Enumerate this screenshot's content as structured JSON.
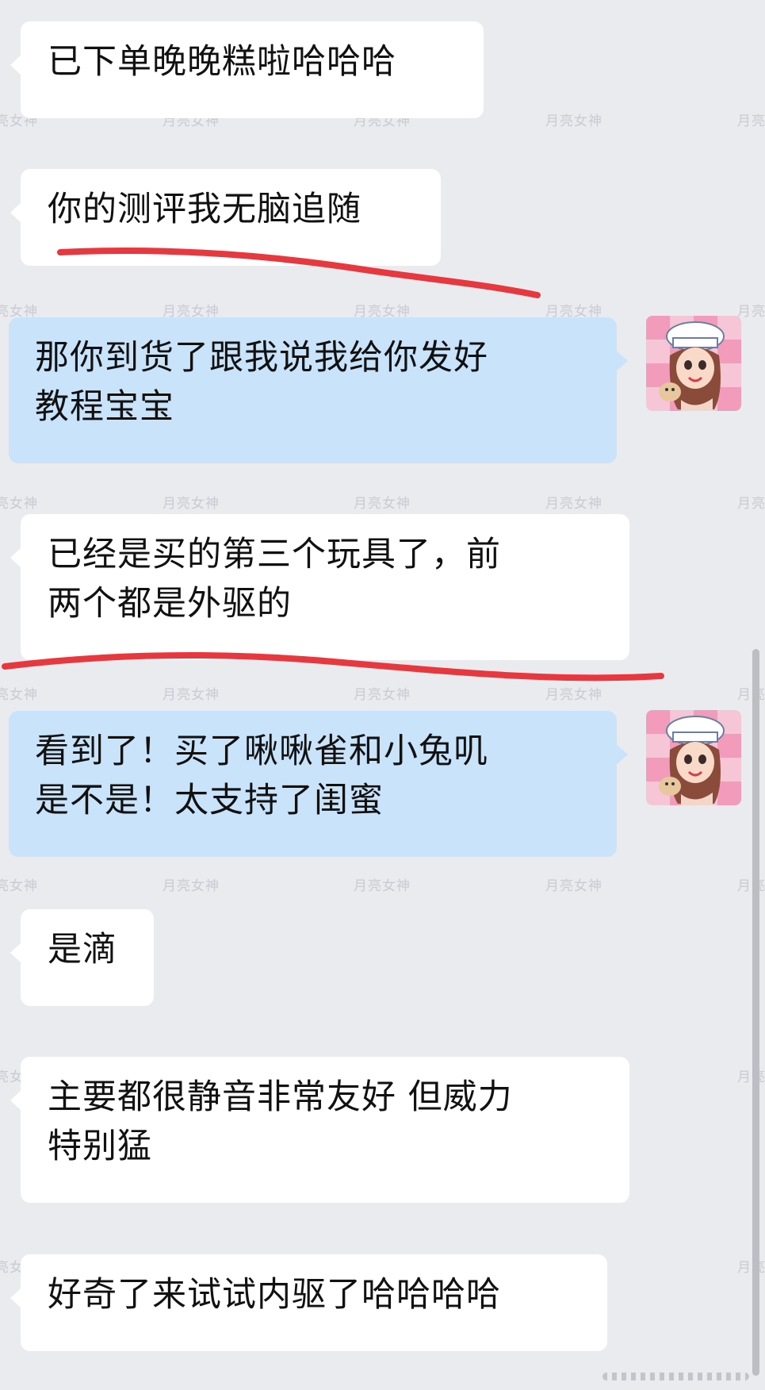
{
  "watermark": "月亮女神",
  "messages": [
    {
      "side": "in",
      "lines": [
        "已下单晚晚糕啦哈哈哈"
      ]
    },
    {
      "side": "in",
      "lines": [
        "你的测评我无脑追随"
      ]
    },
    {
      "side": "out",
      "lines": [
        "那你到货了跟我说我给你发好",
        "教程宝宝"
      ]
    },
    {
      "side": "in",
      "lines": [
        "已经是买的第三个玩具了，前",
        "两个都是外驱的"
      ]
    },
    {
      "side": "out",
      "lines": [
        "看到了！买了啾啾雀和小兔叽",
        "是不是！太支持了闺蜜"
      ]
    },
    {
      "side": "in",
      "lines": [
        "是滴"
      ]
    },
    {
      "side": "in",
      "lines": [
        "主要都很静音非常友好 但威力",
        "特别猛"
      ]
    },
    {
      "side": "in",
      "lines": [
        "好奇了来试试内驱了哈哈哈哈"
      ]
    }
  ],
  "avatar": {
    "icon": "girl-with-chef-hat-avatar"
  },
  "colors": {
    "background": "#eaebef",
    "incoming_bubble": "#ffffff",
    "outgoing_bubble": "#c9e3fb",
    "underline": "#e8383f",
    "watermark": "#c9cbd2"
  }
}
